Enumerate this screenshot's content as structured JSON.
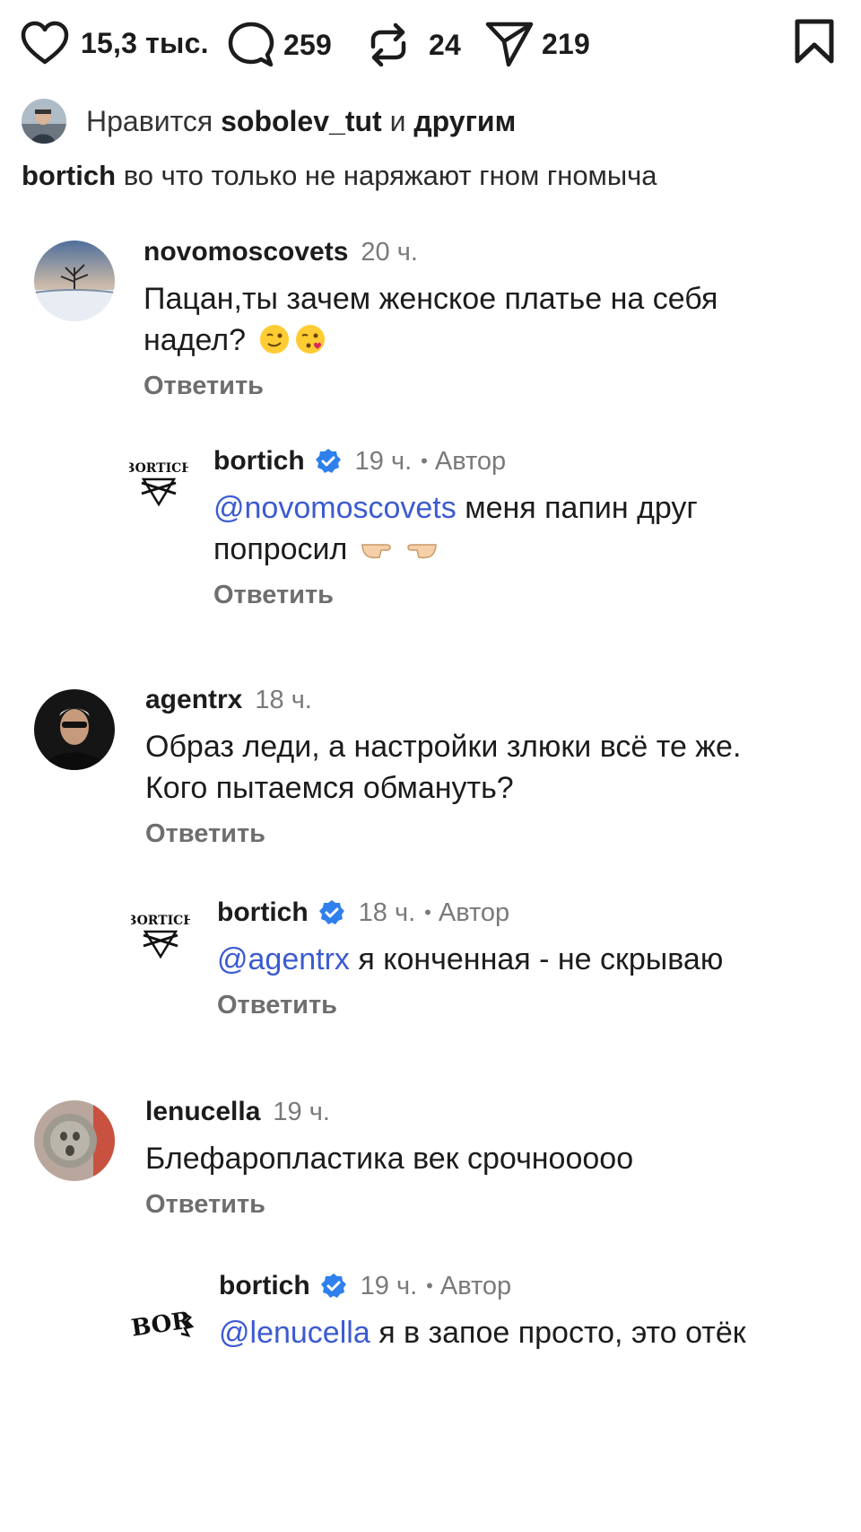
{
  "actions": {
    "likes": "15,3 тыс.",
    "comments": "259",
    "reposts": "24",
    "shares": "219"
  },
  "liked_by": {
    "prefix": "Нравится",
    "user": "sobolev_tut",
    "middle": "и",
    "suffix": "другим"
  },
  "caption": {
    "user": "bortich",
    "text": "во что только не наряжают гном гномыча"
  },
  "reply_label": "Ответить",
  "comments": [
    {
      "user": "novomoscovets",
      "time": "20 ч.",
      "text": "Пацан,ты зачем женское платье на себя надел?",
      "emoji": [
        "winking-face",
        "face-blowing-kiss"
      ]
    },
    {
      "user": "bortich",
      "time": "19 ч.",
      "author": "Автор",
      "mention": "@novomoscovets",
      "text": "меня папин друг попросил",
      "emoji": [
        "pointing-right",
        "pointing-left"
      ]
    },
    {
      "user": "agentrx",
      "time": "18 ч.",
      "text": "Образ леди, а настройки злюки всё те же. Кого пытаемся обмануть?"
    },
    {
      "user": "bortich",
      "time": "18 ч.",
      "author": "Автор",
      "mention": "@agentrx",
      "text": "я конченная - не скрываю"
    },
    {
      "user": "lenucella",
      "time": "19 ч.",
      "text": "Блефаропластика век срочноoooo"
    },
    {
      "user": "bortich",
      "time": "19 ч.",
      "author": "Автор",
      "mention": "@lenucella",
      "text": "я в запое просто, это отёк"
    }
  ],
  "logo_text": {
    "full": "BORTICH",
    "short": "BOR"
  },
  "colors": {
    "mention": "#3c5bd0",
    "verified": "#2f80ed",
    "muted": "#7a7a7a"
  }
}
